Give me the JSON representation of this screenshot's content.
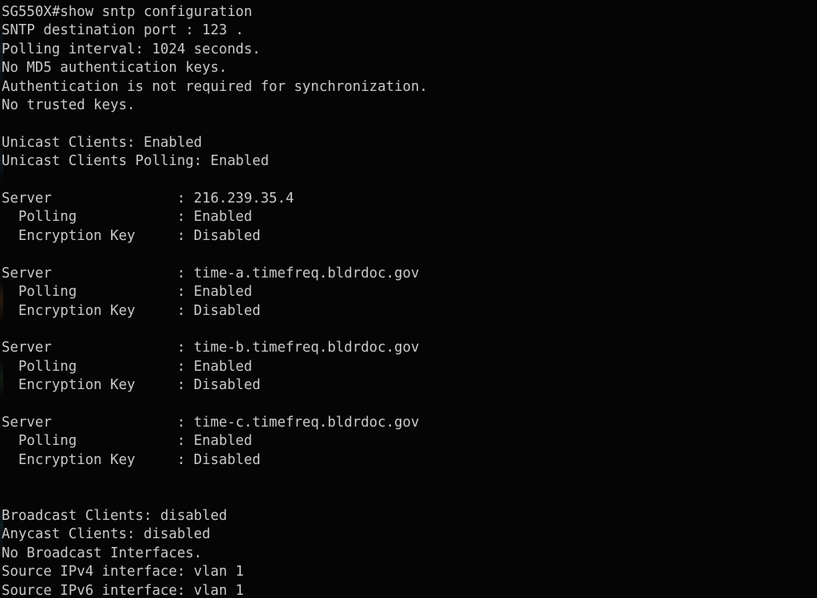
{
  "terminal": {
    "background_color": "#050505",
    "text_color": "#c9c9c9",
    "prompt": "SG550X#",
    "command": "show sntp configuration",
    "device_name": "SG550X",
    "columns": 83,
    "rows": 32
  },
  "header": {
    "destination_port_line": "SNTP destination port : 123 .",
    "polling_interval_line": "Polling interval: 1024 seconds.",
    "md5_keys_line": "No MD5 authentication keys.",
    "authentication_line": "Authentication is not required for synchronization.",
    "trusted_keys_line": "No trusted keys.",
    "destination_port": "123",
    "polling_interval": "1024",
    "polling_interval_units": "seconds"
  },
  "unicast": {
    "clients_line": "Unicast Clients: Enabled",
    "clients_polling_line": "Unicast Clients Polling: Enabled",
    "clients_status": "Enabled",
    "clients_polling_status": "Enabled"
  },
  "servers": [
    {
      "address_line": "Server               : 216.239.35.4",
      "polling_line": "  Polling            : Enabled",
      "encryption_key_line": "  Encryption Key     : Disabled",
      "address": "216.239.35.4",
      "polling": "Enabled",
      "encryption_key": "Disabled"
    },
    {
      "address_line": "Server               : time-a.timefreq.bldrdoc.gov",
      "polling_line": "  Polling            : Enabled",
      "encryption_key_line": "  Encryption Key     : Disabled",
      "address": "time-a.timefreq.bldrdoc.gov",
      "polling": "Enabled",
      "encryption_key": "Disabled"
    },
    {
      "address_line": "Server               : time-b.timefreq.bldrdoc.gov",
      "polling_line": "  Polling            : Enabled",
      "encryption_key_line": "  Encryption Key     : Disabled",
      "address": "time-b.timefreq.bldrdoc.gov",
      "polling": "Enabled",
      "encryption_key": "Disabled"
    },
    {
      "address_line": "Server               : time-c.timefreq.bldrdoc.gov",
      "polling_line": "  Polling            : Enabled",
      "encryption_key_line": "  Encryption Key     : Disabled",
      "address": "time-c.timefreq.bldrdoc.gov",
      "polling": "Enabled",
      "encryption_key": "Disabled"
    }
  ],
  "footer": {
    "broadcast_clients_line": "Broadcast Clients: disabled",
    "anycast_clients_line": "Anycast Clients: disabled",
    "broadcast_interfaces_line": "No Broadcast Interfaces.",
    "source_ipv4_line": "Source IPv4 interface: vlan 1",
    "source_ipv6_line": "Source IPv6 interface: vlan 1",
    "broadcast_clients": "disabled",
    "anycast_clients": "disabled",
    "source_ipv4_interface": "vlan 1",
    "source_ipv6_interface": "vlan 1"
  },
  "command_line": "SG550X#show sntp configuration"
}
